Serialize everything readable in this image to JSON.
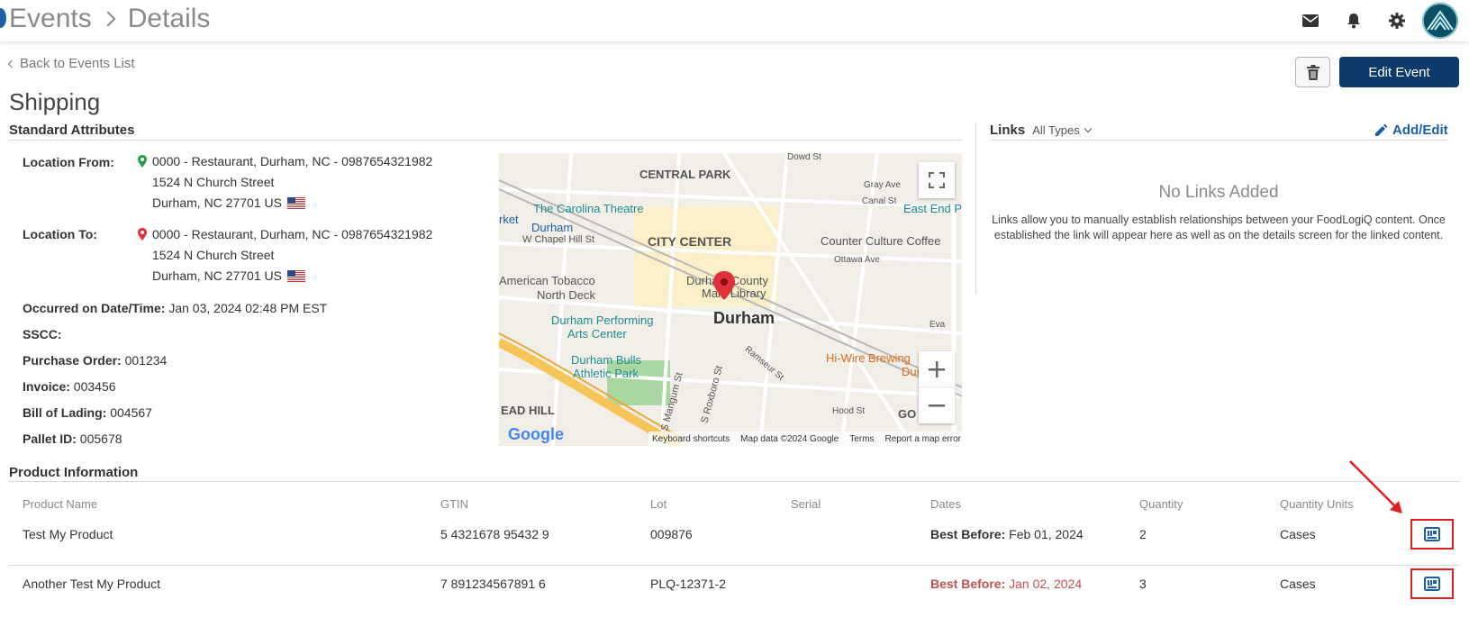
{
  "header": {
    "breadcrumb": [
      "Events",
      "Details"
    ]
  },
  "back_link": "Back to Events List",
  "actions": {
    "edit_label": "Edit Event"
  },
  "page_title": "Shipping",
  "attributes": {
    "section_title": "Standard Attributes",
    "location_from_label": "Location From:",
    "location_from": {
      "name": "0000 - Restaurant, Durham, NC - 0987654321982",
      "street": "1524 N Church Street",
      "city": "Durham, NC 27701 US"
    },
    "location_to_label": "Location To:",
    "location_to": {
      "name": "0000 - Restaurant, Durham, NC - 0987654321982",
      "street": "1524 N Church Street",
      "city": "Durham, NC 27701 US"
    },
    "fields": [
      {
        "label": "Occurred on Date/Time:",
        "value": "Jan 03, 2024 02:48 PM EST"
      },
      {
        "label": "SSCC:",
        "value": ""
      },
      {
        "label": "Purchase Order:",
        "value": "001234"
      },
      {
        "label": "Invoice:",
        "value": "003456"
      },
      {
        "label": "Bill of Lading:",
        "value": "004567"
      },
      {
        "label": "Pallet ID:",
        "value": "005678"
      }
    ]
  },
  "map": {
    "labels": {
      "central_park": "CENTRAL PARK",
      "carolina_theatre": "The Carolina Theatre",
      "rket": "rket",
      "durham_station": "Durham",
      "w_chapel": "W Chapel Hill St",
      "city_center": "CITY CENTER",
      "counter_culture": "Counter Culture Coffee",
      "east_end": "East End P",
      "american_tobacco": "American Tobacco",
      "north_deck": "North Deck",
      "library": "Durham County",
      "library2": "Main Library",
      "durham": "Durham",
      "performing": "Durham Performing",
      "arts_center": "Arts Center",
      "bulls": "Durham Bulls",
      "athletic": "Athletic Park",
      "hiwire": "Hi-Wire Brewing",
      "hiwire2": "Durham",
      "ead_hill": "EAD HILL",
      "go": "GO",
      "ottawa": "Ottawa Ave",
      "mangum": "S Mangum St",
      "roxboro": "S Roxboro St",
      "ramseur": "Ramseur St",
      "hood": "Hood St",
      "eva": "Eva",
      "gray": "Gray Ave",
      "canal": "Canal St",
      "dowd": "Dowd St"
    },
    "footer": {
      "google": "Google",
      "shortcuts": "Keyboard shortcuts",
      "data": "Map data ©2024 Google",
      "terms": "Terms",
      "report": "Report a map error"
    }
  },
  "links": {
    "title": "Links",
    "filter": "All Types",
    "add_edit": "Add/Edit",
    "empty_title": "No Links Added",
    "empty_help": "Links allow you to manually establish relationships between your FoodLogiQ content. Once established the link will appear here as well as on the details screen for the linked content."
  },
  "products": {
    "section_title": "Product Information",
    "columns": [
      "Product Name",
      "GTIN",
      "Lot",
      "Serial",
      "Dates",
      "Quantity",
      "Quantity Units"
    ],
    "rows": [
      {
        "name": "Test My Product",
        "gtin": "5 4321678 95432 9",
        "lot": "009876",
        "serial": "",
        "date_label": "Best Before:",
        "date": "Feb 01, 2024",
        "quantity": "2",
        "units": "Cases"
      },
      {
        "name": "Another Test My Product",
        "gtin": "7 891234567891 6",
        "lot": "PLQ-12371-2",
        "serial": "",
        "date_label": "Best Before:",
        "date": "Jan 02, 2024",
        "quantity": "3",
        "units": "Cases"
      }
    ]
  },
  "colors": {
    "primary": "#0b3a6b",
    "link": "#1a5fa8",
    "expired": "#c0504d",
    "highlight": "#e02020"
  }
}
